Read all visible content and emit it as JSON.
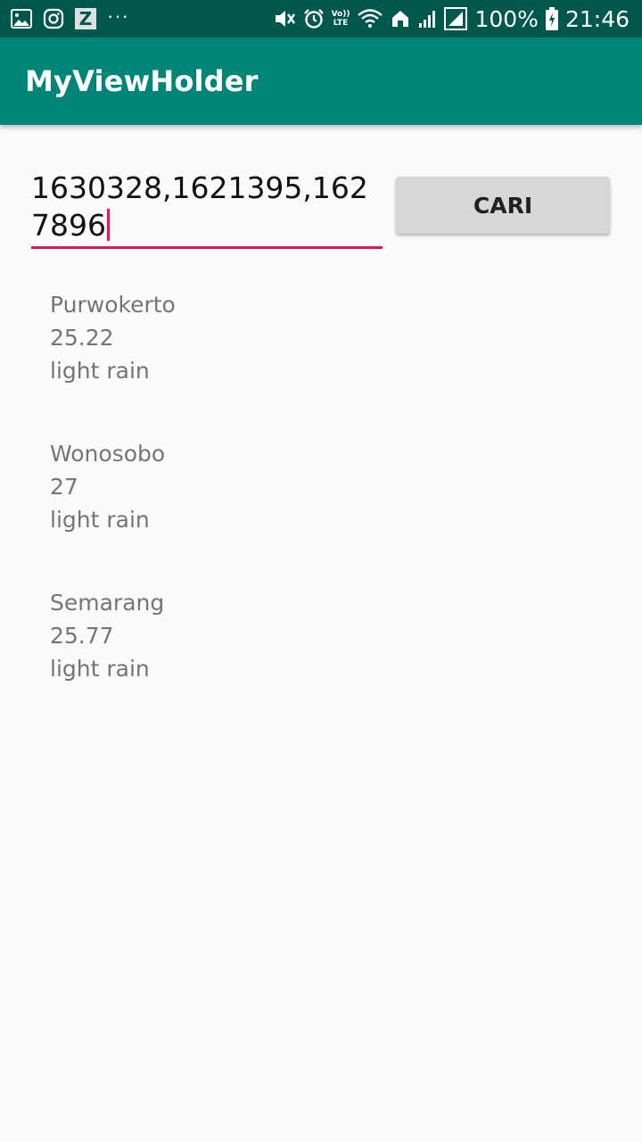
{
  "status_bar": {
    "left_icons": [
      "image-icon",
      "instagram-icon",
      "z-app-icon",
      "more-dots-icon"
    ],
    "z_letter": "Z",
    "dots": "···",
    "right_icons": [
      "mute-icon",
      "alarm-icon",
      "volte-icon",
      "wifi-icon",
      "home-icon",
      "signal-icon",
      "signal-icon",
      "battery-icon"
    ],
    "volte_top": "Vo))",
    "volte_bottom": "LTE",
    "battery_percent": "100%",
    "time": "21:46"
  },
  "app_bar": {
    "title": "MyViewHolder"
  },
  "search": {
    "value": "1630328,1621395,1627896"
  },
  "search_button": {
    "label": "CARI"
  },
  "colors": {
    "status_bar": "#00574b",
    "app_bar": "#008577",
    "accent": "#d81b60",
    "background": "#fafafa",
    "button": "#d6d7d7",
    "secondary_text": "#757575"
  },
  "weather_items": [
    {
      "city": "Purwokerto",
      "temperature": "25.22",
      "description": "light rain"
    },
    {
      "city": "Wonosobo",
      "temperature": "27",
      "description": "light rain"
    },
    {
      "city": "Semarang",
      "temperature": "25.77",
      "description": "light rain"
    }
  ]
}
